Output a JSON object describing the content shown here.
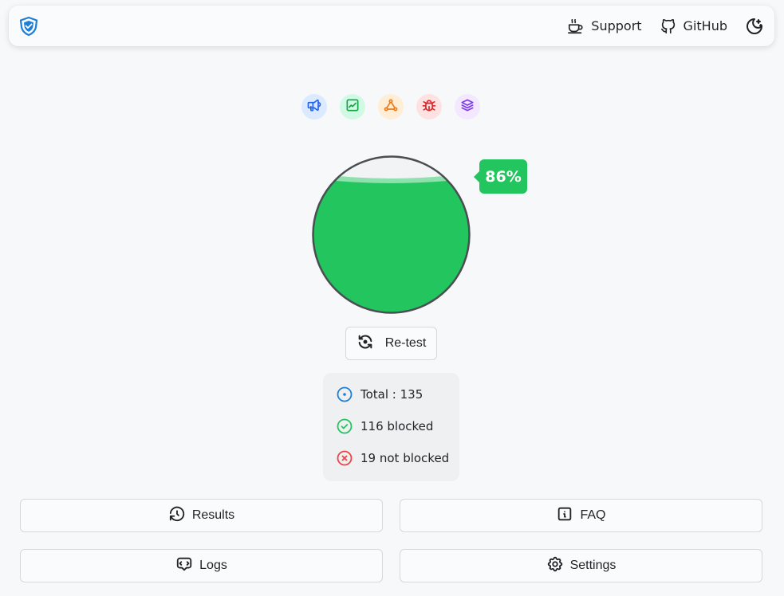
{
  "nav": {
    "support_label": "Support",
    "github_label": "GitHub"
  },
  "categories": [
    "ads-icon",
    "analytics-icon",
    "tracker-icon",
    "bug-icon",
    "layers-icon"
  ],
  "score": {
    "percent": 86,
    "label": "86%",
    "color": "#22c55e"
  },
  "retest_label": "Re-test",
  "stats": {
    "total": "Total : 135",
    "blocked": "116 blocked",
    "not_blocked": "19 not blocked"
  },
  "actions": {
    "results": "Results",
    "faq": "FAQ",
    "logs": "Logs",
    "settings": "Settings"
  }
}
